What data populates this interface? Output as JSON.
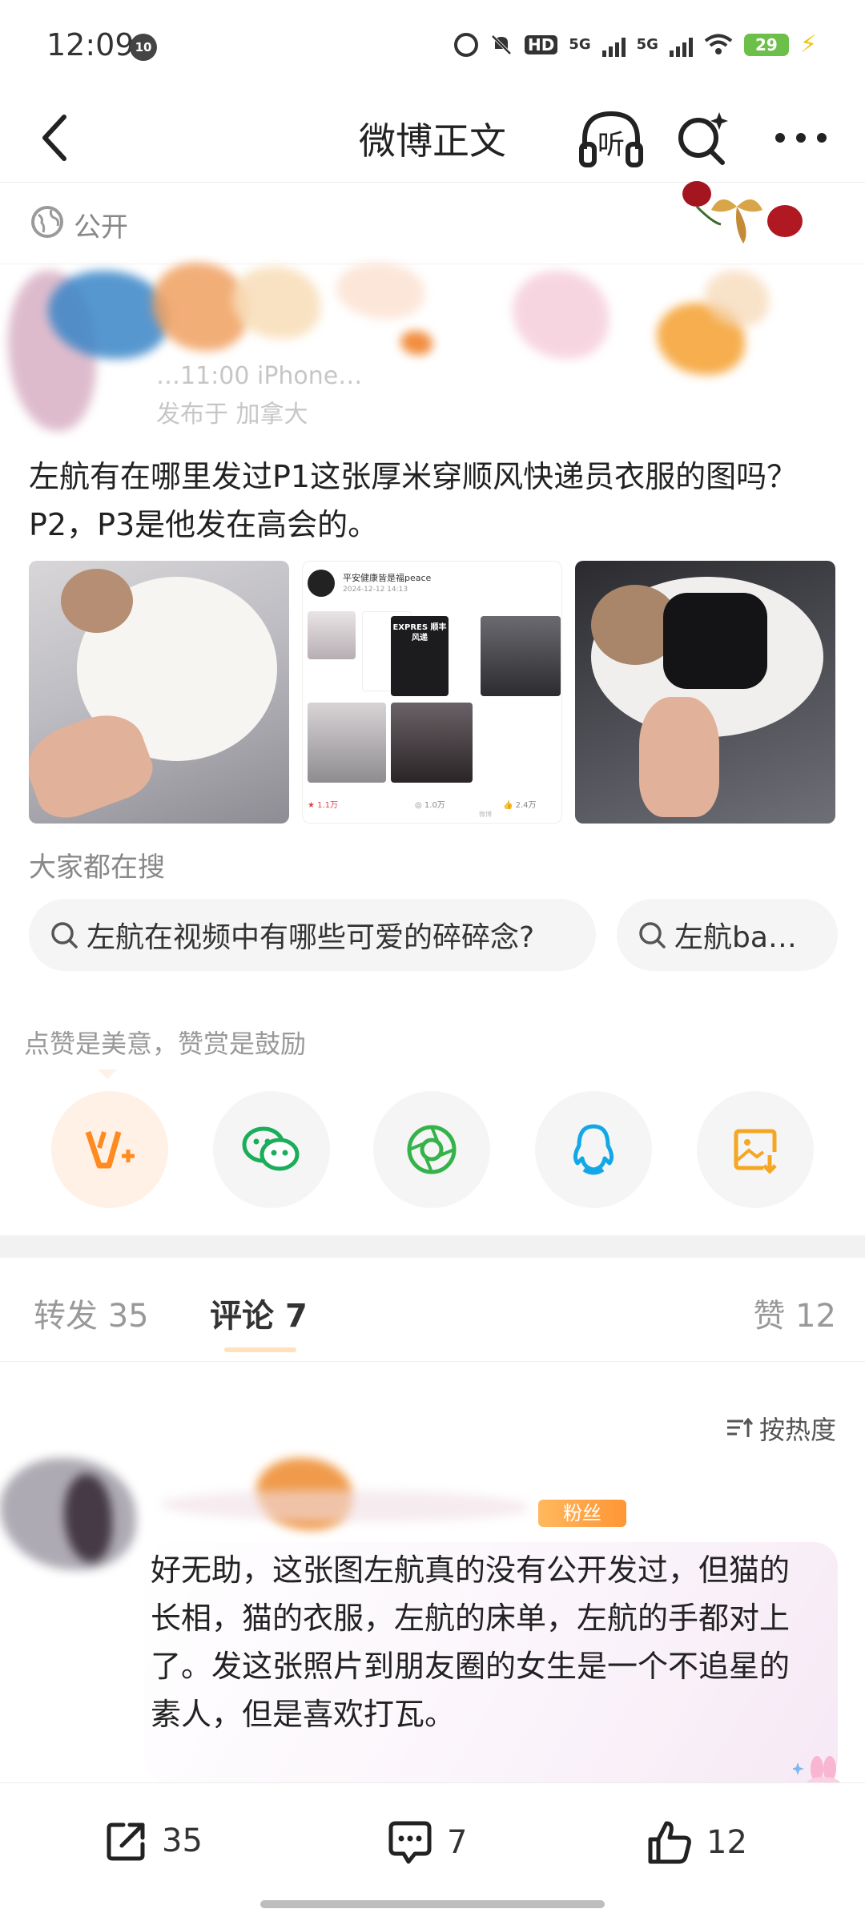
{
  "status_bar": {
    "time": "12:09",
    "notification_badge": "10",
    "network_1": "5G",
    "network_2": "5G",
    "hd_label": "HD",
    "battery": "29"
  },
  "header": {
    "title": "微博正文",
    "listen_label": "听"
  },
  "post": {
    "visibility": "公开",
    "author_meta_line1": "…11:00 iPhone…",
    "author_meta_line2": "发布于 加拿大",
    "text": "左航有在哪里发过P1这张厚米穿顺风快递员衣服的图吗？P2，P3是他发在高会的。",
    "embedded_screenshot": {
      "account_name": "平安健康皆是福peace",
      "date": "2024-12-12 14:13",
      "likes": "1.1万",
      "comments": "1.0万",
      "reposts": "2.4万",
      "shirt_text": "EXPRES 顺丰 风递",
      "watermark": "微博"
    }
  },
  "search_suggestions": {
    "heading": "大家都在搜",
    "chips": [
      {
        "label": "左航在视频中有哪些可爱的碎碎念?"
      },
      {
        "label": "左航ba…"
      }
    ]
  },
  "support": {
    "hint": "点赞是美意，赞赏是鼓励",
    "buttons": [
      {
        "name": "reward",
        "icon": "reward-v-plus-icon",
        "color": "#ff8a1f"
      },
      {
        "name": "wechat",
        "icon": "wechat-icon",
        "color": "#1aad5a"
      },
      {
        "name": "moments",
        "icon": "wechat-moments-icon",
        "color": "#35b34a"
      },
      {
        "name": "qq",
        "icon": "qq-icon",
        "color": "#12a8e8"
      },
      {
        "name": "save-image",
        "icon": "save-image-icon",
        "color": "#f5a623"
      }
    ]
  },
  "tabs": {
    "repost_label": "转发",
    "repost_count": "35",
    "comment_label": "评论",
    "comment_count": "7",
    "like_label": "赞",
    "like_count": "12"
  },
  "sort": {
    "label": "按热度"
  },
  "comment": {
    "badge": "粉丝",
    "text": "好无助，这张图左航真的没有公开发过，但猫的长相，猫的衣服，左航的床单，左航的手都对上了。发这张照片到朋友圈的女生是一个不追星的素人，但是喜欢打瓦。"
  },
  "bottom_bar": {
    "repost_count": "35",
    "comment_count": "7",
    "like_count": "12"
  },
  "colors": {
    "accent_orange": "#ff8a1f",
    "text_primary": "#222222",
    "text_secondary": "#888888"
  }
}
